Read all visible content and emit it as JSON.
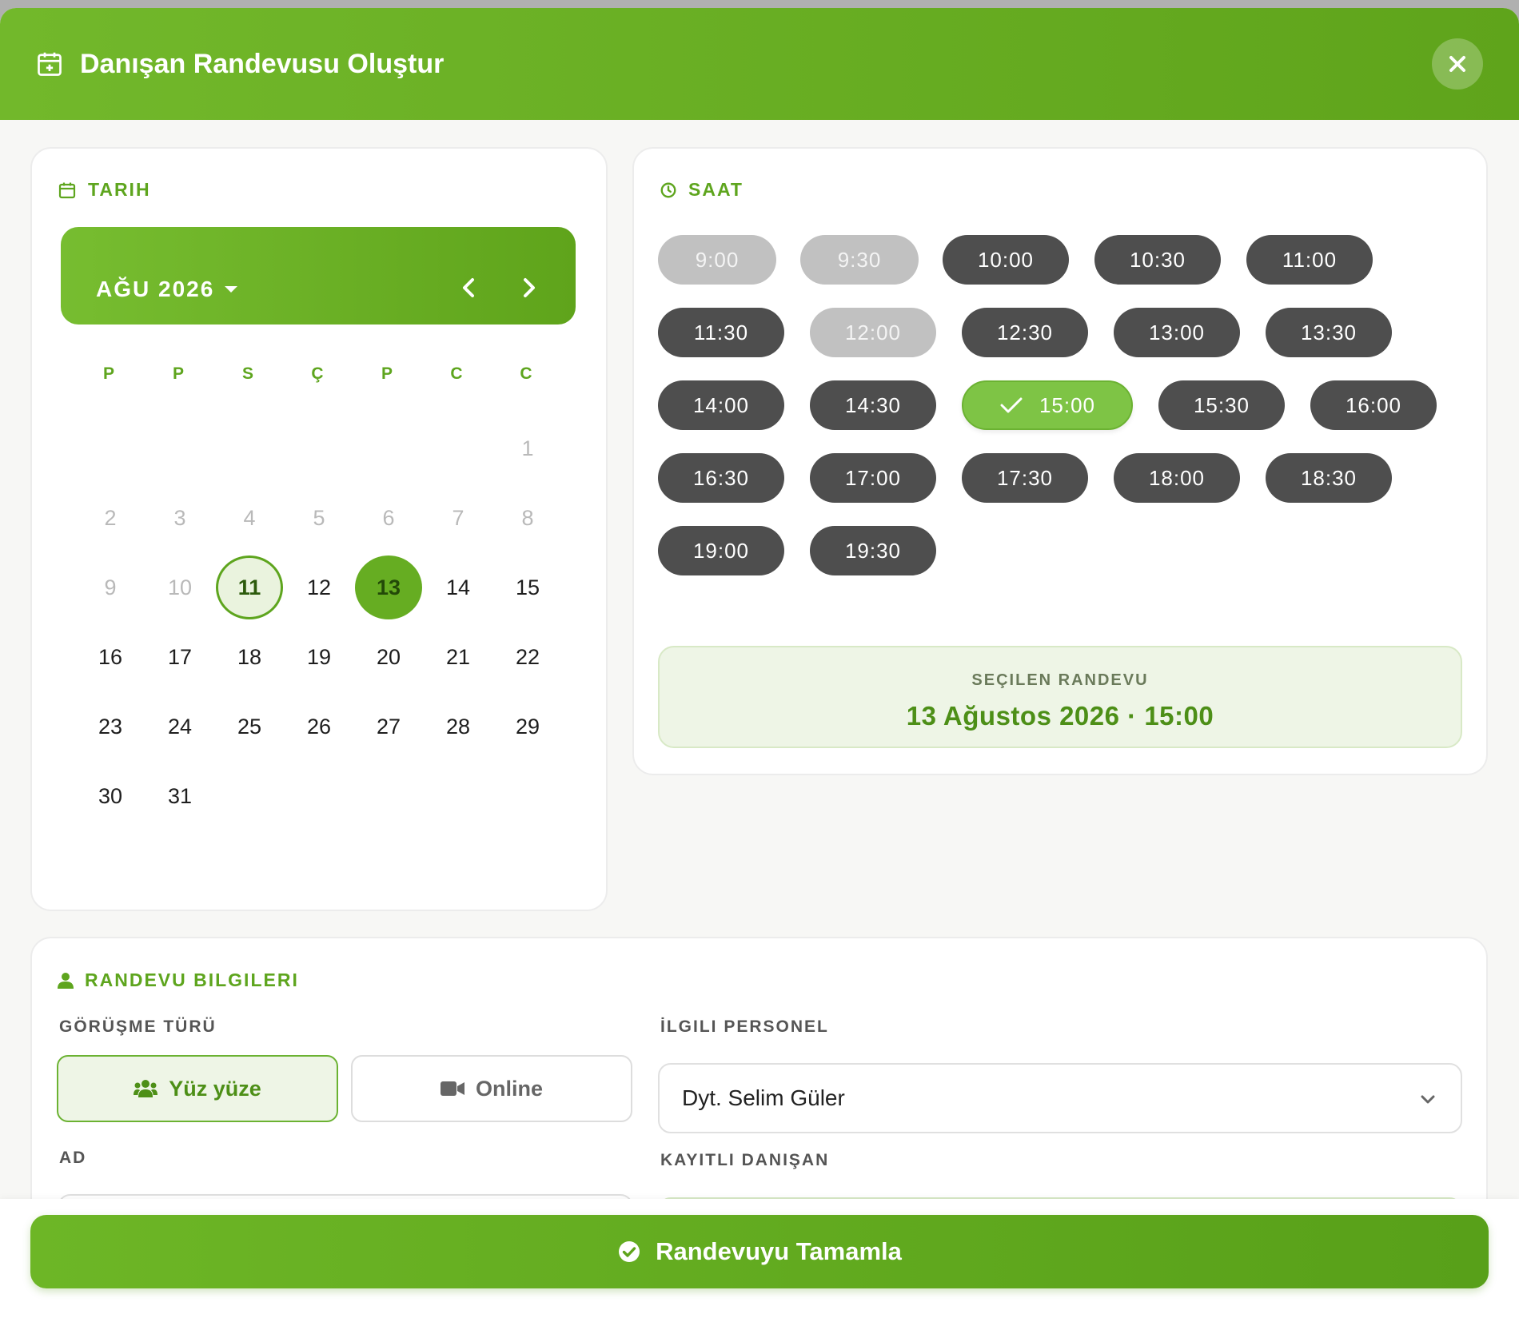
{
  "header": {
    "title": "Danışan Randevusu Oluştur",
    "close_icon": "close-icon"
  },
  "date_section": {
    "title": "TARIH",
    "month_label": "AĞU 2026",
    "weekdays": [
      "P",
      "P",
      "S",
      "Ç",
      "P",
      "C",
      "C"
    ],
    "days": [
      "1",
      "2",
      "3",
      "4",
      "5",
      "6",
      "7",
      "8",
      "9",
      "10",
      "11",
      "12",
      "13",
      "14",
      "15",
      "16",
      "17",
      "18",
      "19",
      "20",
      "21",
      "22",
      "23",
      "24",
      "25",
      "26",
      "27",
      "28",
      "29",
      "30",
      "31"
    ],
    "today": "11",
    "selected": "13"
  },
  "time_section": {
    "title": "SAAT",
    "slots": [
      "9:00",
      "9:30",
      "10:00",
      "10:30",
      "11:00",
      "11:30",
      "12:00",
      "12:30",
      "13:00",
      "13:30",
      "14:00",
      "14:30",
      "15:00",
      "15:30",
      "16:00",
      "16:30",
      "17:00",
      "17:30",
      "18:00",
      "18:30",
      "19:00",
      "19:30"
    ],
    "unavailable": [
      "9:00",
      "9:30",
      "12:00"
    ],
    "selected": "15:00",
    "summary_label": "SEÇILEN RANDEVU",
    "summary_value": "13 Ağustos 2026 · 15:00"
  },
  "info_section": {
    "title": "RANDEVU BILGILERI",
    "meeting_type_label": "GÖRÜŞME TÜRÜ",
    "face_to_face": "Yüz yüze",
    "online": "Online",
    "staff_label": "İLGILI PERSONEL",
    "staff_value": "Dyt. Selim Güler",
    "name_label": "AD",
    "registered_label": "KAYITLI DANIŞAN"
  },
  "footer": {
    "submit_label": "Randevuyu Tamamla"
  },
  "colors": {
    "accent": "#66ad22",
    "slot_dark": "#4e4e4e",
    "slot_disabled": "#c1c1c1"
  }
}
